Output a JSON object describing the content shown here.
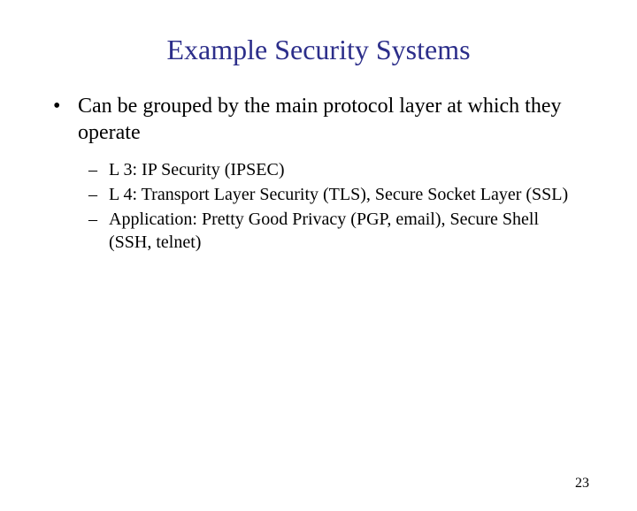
{
  "title": "Example Security Systems",
  "bullets": {
    "main": "Can be grouped by the main protocol layer at which they operate",
    "sub": [
      "L 3: IP Security (IPSEC)",
      "L 4: Transport Layer Security (TLS), Secure Socket Layer (SSL)",
      "Application: Pretty Good Privacy (PGP, email), Secure Shell (SSH, telnet)"
    ]
  },
  "page_number": "23"
}
